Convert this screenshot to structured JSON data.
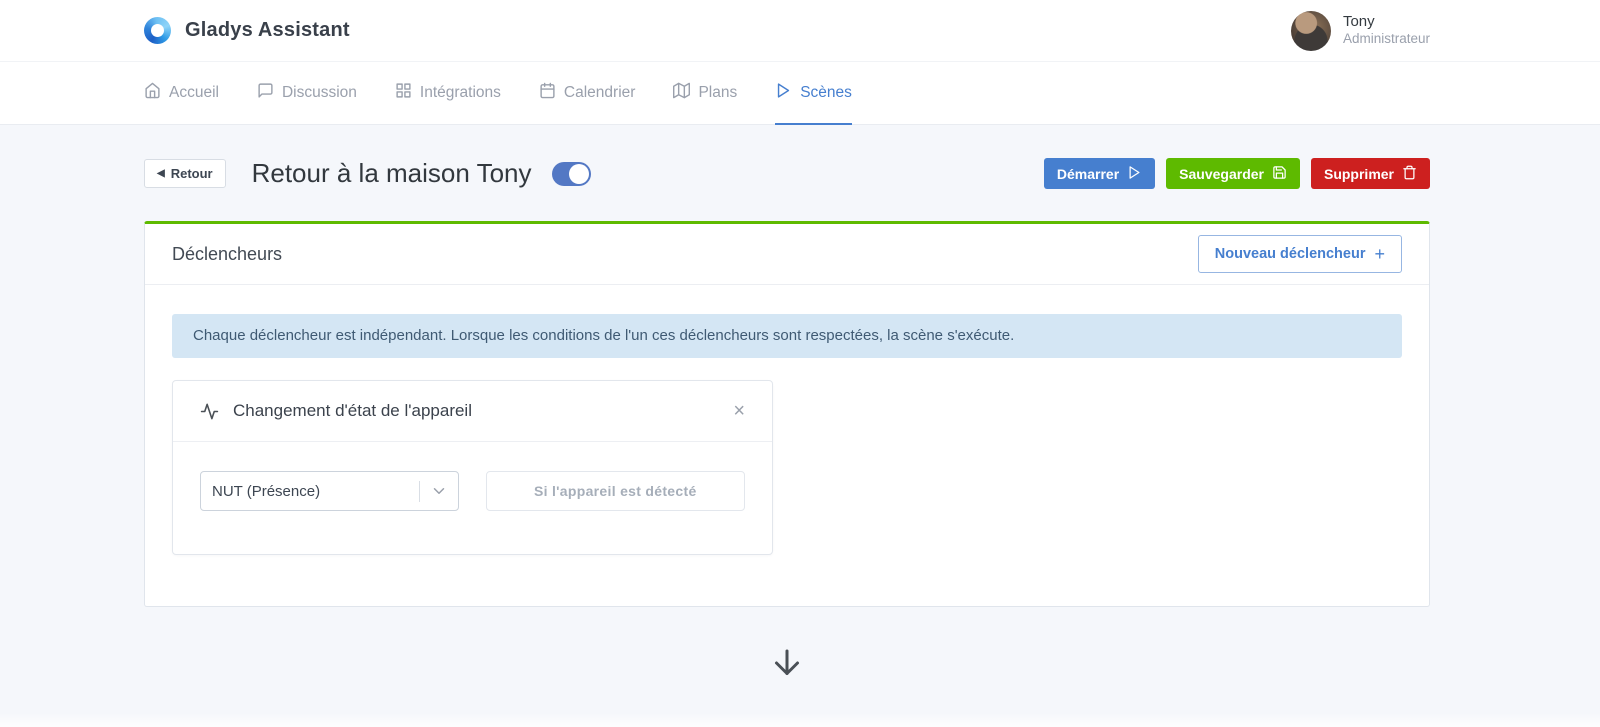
{
  "header": {
    "app_title": "Gladys Assistant",
    "user": {
      "name": "Tony",
      "role": "Administrateur"
    }
  },
  "nav": {
    "items": [
      {
        "label": "Accueil",
        "icon": "home-icon",
        "active": false
      },
      {
        "label": "Discussion",
        "icon": "message-icon",
        "active": false
      },
      {
        "label": "Intégrations",
        "icon": "grid-icon",
        "active": false
      },
      {
        "label": "Calendrier",
        "icon": "calendar-icon",
        "active": false
      },
      {
        "label": "Plans",
        "icon": "map-icon",
        "active": false
      },
      {
        "label": "Scènes",
        "icon": "play-icon",
        "active": true
      }
    ]
  },
  "page": {
    "back_button_label": "Retour",
    "title": "Retour à la maison Tony",
    "scene_toggle_state": "on",
    "actions": {
      "start": {
        "label": "Démarrer",
        "icon": "play-icon",
        "color": "#467fcf"
      },
      "save": {
        "label": "Sauvegarder",
        "icon": "save-icon",
        "color": "#5eba00"
      },
      "delete": {
        "label": "Supprimer",
        "icon": "trash-icon",
        "color": "#cd201f"
      }
    }
  },
  "triggers": {
    "card_title": "Déclencheurs",
    "new_trigger_label": "Nouveau déclencheur",
    "info_text": "Chaque déclencheur est indépendant. Lorsque les conditions de l'un ces déclencheurs sont respectées, la scène s'exécute.",
    "trigger": {
      "title": "Changement d'état de l'appareil",
      "title_icon": "activity-icon",
      "device_select_value": "NUT (Présence)",
      "condition_button_label": "Si l'appareil est détecté"
    }
  },
  "icons": {
    "back": "◀",
    "plus": "+",
    "close": "×"
  },
  "colors": {
    "accent_blue": "#467fcf",
    "success_green": "#5eba00",
    "danger_red": "#cd201f",
    "card_top_border": "#5eba00",
    "info_bg": "#d4e6f4",
    "page_bg": "#f5f7fb"
  }
}
